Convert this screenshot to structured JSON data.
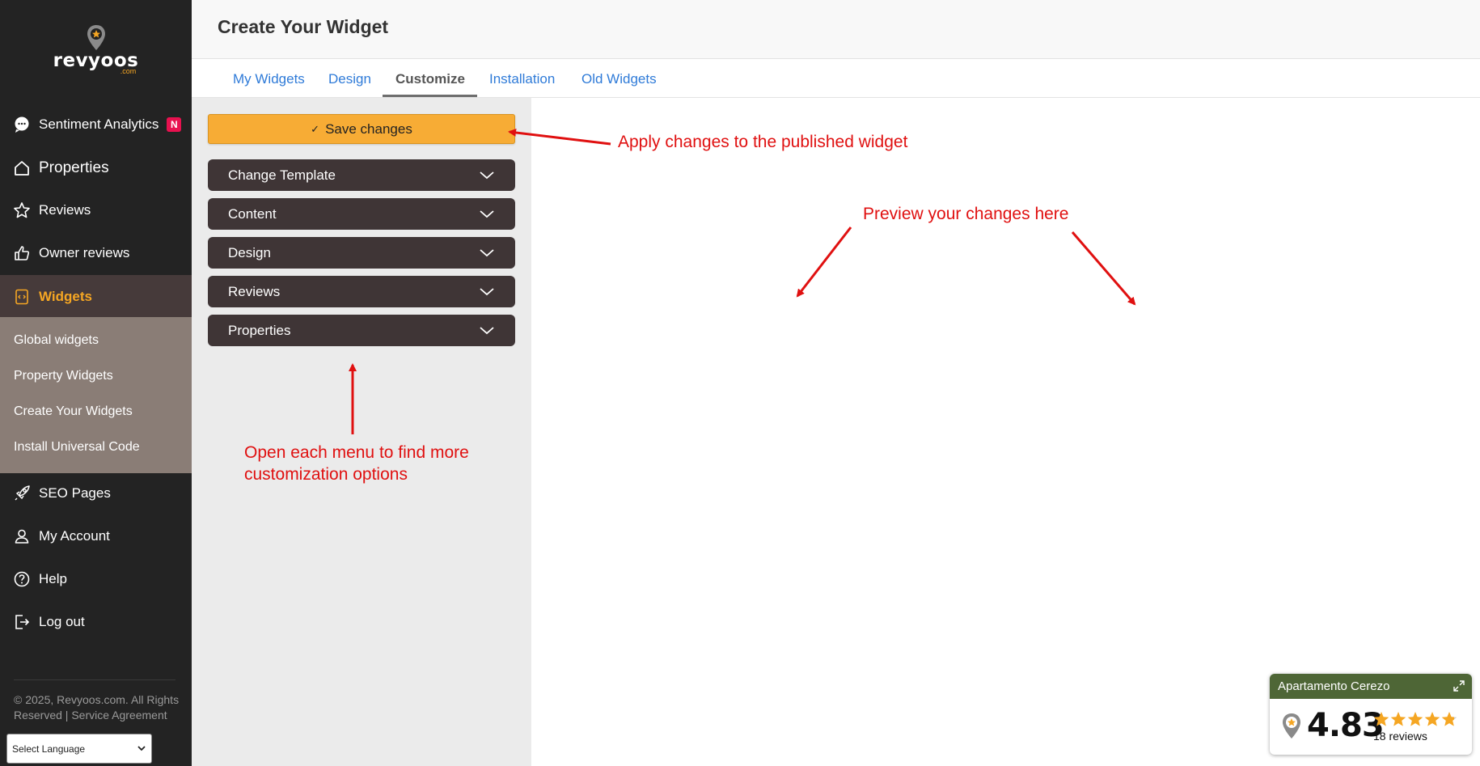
{
  "brand": {
    "name": "revyoos",
    "suffix": ".com",
    "accent": "#f5a623"
  },
  "sidebar": {
    "items": [
      {
        "label": "Sentiment Analytics",
        "icon": "chat-bubble-icon",
        "badge": "N"
      },
      {
        "label": "Properties",
        "icon": "home-icon"
      },
      {
        "label": "Reviews",
        "icon": "star-icon"
      },
      {
        "label": "Owner reviews",
        "icon": "thumbs-up-icon"
      },
      {
        "label": "Widgets",
        "icon": "widget-code-icon",
        "active": true
      },
      {
        "label": "SEO Pages",
        "icon": "rocket-icon"
      },
      {
        "label": "My Account",
        "icon": "user-icon"
      },
      {
        "label": "Help",
        "icon": "help-circle-icon"
      },
      {
        "label": "Log out",
        "icon": "logout-icon"
      }
    ],
    "submenu": [
      {
        "label": "Global widgets"
      },
      {
        "label": "Property Widgets"
      },
      {
        "label": "Create Your Widgets"
      },
      {
        "label": "Install Universal Code"
      }
    ],
    "copyright": "© 2025, Revyoos.com. All Rights Reserved | Service Agreement",
    "language_select": "Select Language"
  },
  "header": {
    "title": "Create Your Widget"
  },
  "tabs": [
    {
      "label": "My Widgets"
    },
    {
      "label": "Design"
    },
    {
      "label": "Customize",
      "active": true
    },
    {
      "label": "Installation"
    },
    {
      "label": "Old Widgets"
    }
  ],
  "panel": {
    "save_label": "Save changes",
    "sections": [
      {
        "label": "Change Template"
      },
      {
        "label": "Content"
      },
      {
        "label": "Design"
      },
      {
        "label": "Reviews"
      },
      {
        "label": "Properties"
      }
    ]
  },
  "annotations": {
    "save": "Apply changes to the published widget",
    "preview": "Preview your changes here",
    "menus_line1": "Open each menu to find more",
    "menus_line2": "customization options",
    "color": "#e01010"
  },
  "review_widget": {
    "property": "Apartamento Cerezo",
    "score": "4.83",
    "count": "18 reviews",
    "stars": 4.83,
    "header_color": "#4e6636"
  }
}
